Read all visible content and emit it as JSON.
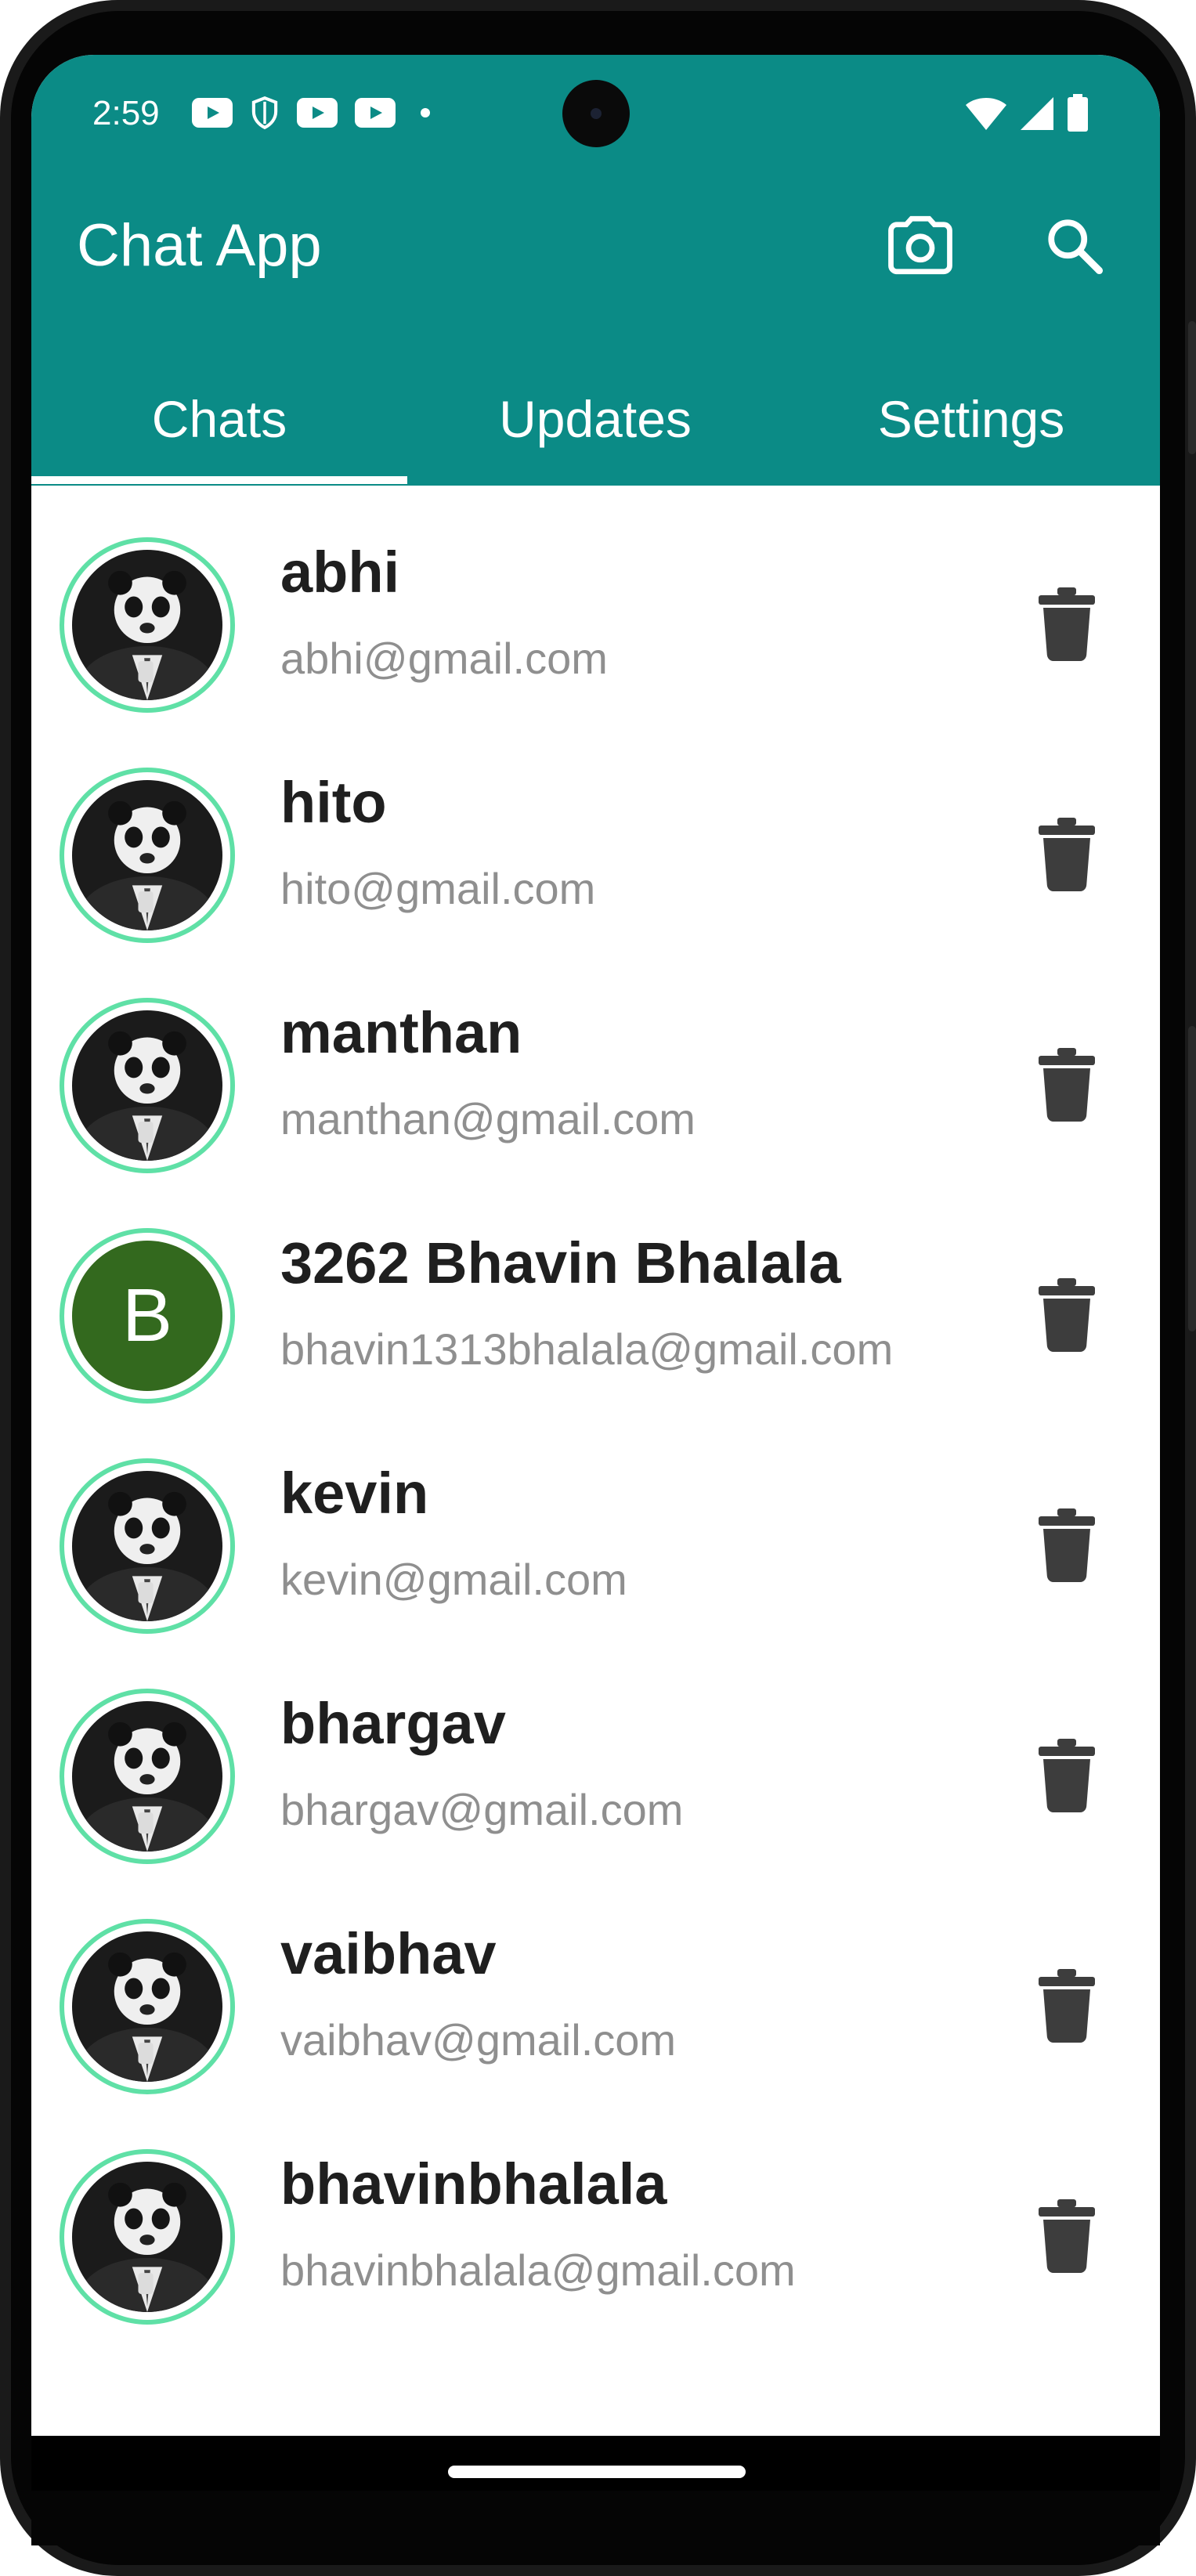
{
  "status_bar": {
    "time": "2:59",
    "icons_left": [
      "youtube-icon",
      "shield-icon",
      "youtube-icon",
      "youtube-icon",
      "notification-dot"
    ],
    "icons_right": [
      "wifi-icon",
      "signal-icon",
      "battery-icon"
    ]
  },
  "app_bar": {
    "title": "Chat App",
    "actions": [
      "camera-icon",
      "search-icon"
    ],
    "background_color": "#0b8b86"
  },
  "tabs": [
    {
      "label": "Chats",
      "selected": true
    },
    {
      "label": "Updates",
      "selected": false
    },
    {
      "label": "Settings",
      "selected": false
    }
  ],
  "chats": [
    {
      "name": "abhi",
      "email": "abhi@gmail.com",
      "avatar": "panda-photo"
    },
    {
      "name": "hito",
      "email": "hito@gmail.com",
      "avatar": "panda-photo"
    },
    {
      "name": "manthan",
      "email": "manthan@gmail.com",
      "avatar": "panda-photo"
    },
    {
      "name": "3262 Bhavin Bhalala",
      "email": "bhavin1313bhalala@gmail.com",
      "avatar": "letter",
      "avatar_letter": "B",
      "avatar_color": "#33691e"
    },
    {
      "name": "kevin",
      "email": "kevin@gmail.com",
      "avatar": "panda-photo"
    },
    {
      "name": "bhargav",
      "email": "bhargav@gmail.com",
      "avatar": "panda-photo"
    },
    {
      "name": "vaibhav",
      "email": "vaibhav@gmail.com",
      "avatar": "panda-photo"
    },
    {
      "name": "bhavinbhalala",
      "email": "bhavinbhalala@gmail.com",
      "avatar": "panda-photo"
    }
  ],
  "row_actions": {
    "delete_icon": "trash-icon"
  },
  "colors": {
    "avatar_ring": "#5fe0a6",
    "name_text": "#1f1f1f",
    "email_text": "#8f8f8f",
    "delete_icon": "#3d3d3d"
  }
}
